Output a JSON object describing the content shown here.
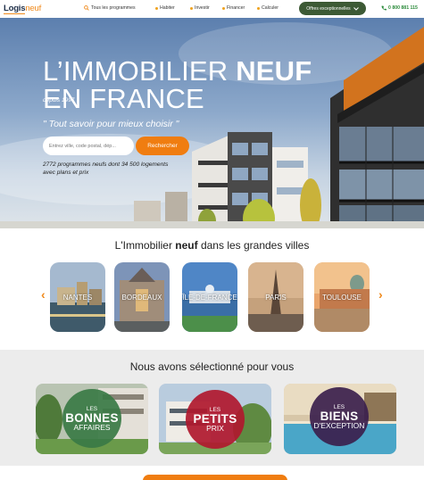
{
  "nav": {
    "logo_part1": "Logis",
    "logo_part2": "neuf",
    "items": [
      {
        "label": "Tous les programmes",
        "icon": "search-icon"
      },
      {
        "label": "Habiter",
        "icon": "dot-icon"
      },
      {
        "label": "Investir",
        "icon": "dot-icon"
      },
      {
        "label": "Financer",
        "icon": "dot-icon"
      },
      {
        "label": "Calculer",
        "icon": "dot-icon"
      }
    ],
    "offers_label": "Offres exceptionnelles",
    "phone": "0 800 881 115",
    "accent_color": "#f08a1c",
    "offers_color": "#3d5a35",
    "phone_color": "#2a8a3a"
  },
  "hero": {
    "title_line1_a": "L’IMMOBILIER ",
    "title_line1_b": "NEUF",
    "title_line2": "EN FRANCE",
    "since": "depuis 1997",
    "tagline": "\" Tout savoir pour mieux choisir \"",
    "search_placeholder": "Entrez ville, code postal, dép...",
    "search_button": "Rechercher",
    "stats": "2772 programmes neufs dont 34 500 logements avec plans et prix"
  },
  "cities": {
    "title_a": "L'Immobilier ",
    "title_b": "neuf",
    "title_c": " dans les grandes villes",
    "items": [
      {
        "name": "NANTES"
      },
      {
        "name": "BORDEAUX"
      },
      {
        "name": "ÎLE-DE-FRANCE"
      },
      {
        "name": "PARIS"
      },
      {
        "name": "TOULOUSE"
      }
    ]
  },
  "selection": {
    "title": "Nous avons sélectionné pour vous",
    "cards": [
      {
        "small": "LES",
        "big": "BONNES",
        "sub": "AFFAIRES",
        "color": "#3a7a45"
      },
      {
        "small": "LES",
        "big": "PETITS",
        "sub": "PRIX",
        "color": "#b0182e"
      },
      {
        "small": "LES",
        "big": "BIENS",
        "sub": "D'EXCEPTION",
        "color": "#3b1f4d"
      }
    ]
  }
}
